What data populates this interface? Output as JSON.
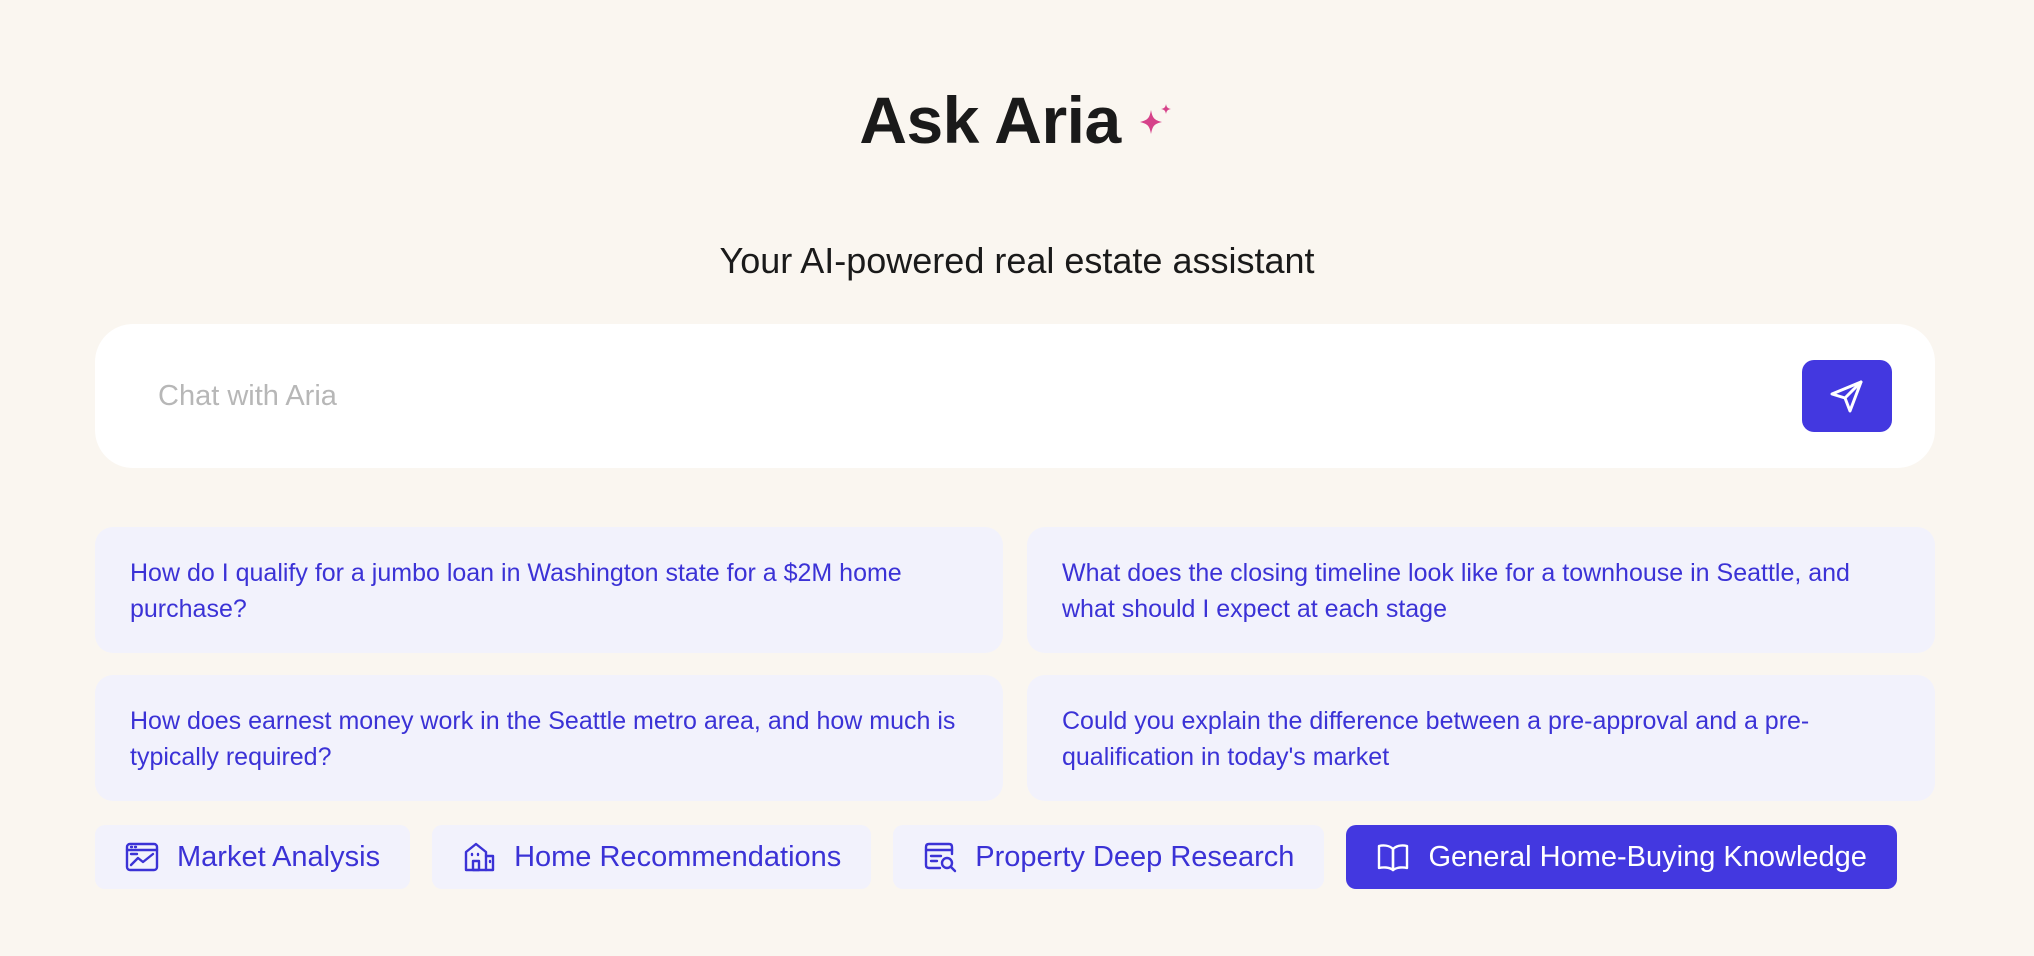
{
  "header": {
    "title": "Ask Aria",
    "sparkle_icon": "sparkle-icon",
    "subtitle": "Your AI-powered real estate assistant"
  },
  "chat": {
    "placeholder": "Chat with Aria",
    "value": "",
    "send_icon": "send-icon"
  },
  "suggestions": [
    "How do I qualify for a jumbo loan in Washington state for a $2M home purchase?",
    "What does the closing timeline look like for a townhouse in Seattle, and what should I expect at each stage",
    "How does earnest money work in the Seattle metro area, and how much is typically required?",
    "Could you explain the difference between a pre-approval and a pre-qualification in today's market"
  ],
  "modes": [
    {
      "label": "Market Analysis",
      "icon": "chart-window-icon",
      "active": false
    },
    {
      "label": "Home Recommendations",
      "icon": "building-icon",
      "active": false
    },
    {
      "label": "Property Deep Research",
      "icon": "search-document-icon",
      "active": false
    },
    {
      "label": "General Home-Buying Knowledge",
      "icon": "book-icon",
      "active": true
    }
  ],
  "colors": {
    "background": "#faf6f0",
    "accent": "#4338e0",
    "sparkle": "#d6428a",
    "chip_background": "#f2f2fc",
    "chip_text": "#3b32d6"
  }
}
